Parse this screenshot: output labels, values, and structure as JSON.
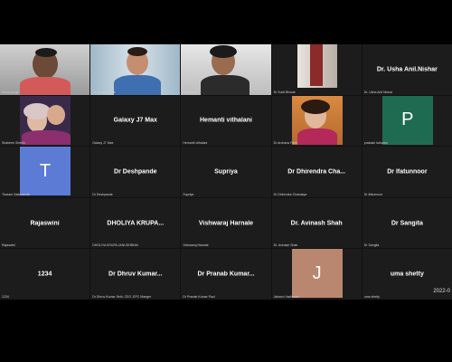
{
  "tiles": [
    {
      "center": "",
      "label": "aruna pooja"
    },
    {
      "center": "",
      "label": "Dr Archana Pate"
    },
    {
      "center": "",
      "label": "Ruhi Jasvi"
    },
    {
      "center": "",
      "label": "Dr Sunil Bhosle"
    },
    {
      "center": "Dr. Usha Anil.Nishar",
      "label": "Dr. Usha Anil Nishar"
    },
    {
      "center": "",
      "label": "Shaheen Sheikh"
    },
    {
      "center": "Galaxy J7 Max",
      "label": "Galaxy J7 Max"
    },
    {
      "center": "Hemanti vithalani",
      "label": "Hemanti vithalani"
    },
    {
      "center": "",
      "label": "Dr Archana Patel"
    },
    {
      "center": "",
      "label": "prakash bahadur"
    },
    {
      "center": "",
      "label": "Tharani Gaikwander"
    },
    {
      "center": "Dr Deshpande",
      "label": "Dr Deshpande"
    },
    {
      "center": "Supriya",
      "label": "Supriya"
    },
    {
      "center": "Dr Dhirendra Cha...",
      "label": "Dr Dhirendra Chanakya"
    },
    {
      "center": "Dr Ifatunnoor",
      "label": "Dr Ifatunnoor"
    },
    {
      "center": "Rajaswini",
      "label": "Rajaswini"
    },
    {
      "center": "DHOLIYA KRUPA...",
      "label": "DHOLIYA KRUPA JANUSHBHAI"
    },
    {
      "center": "Vishwaraj Harnale",
      "label": "Vishwaraj Harnale"
    },
    {
      "center": "Dr. Avinash Shah",
      "label": "Dr. Avinash Shah"
    },
    {
      "center": "Dr Sangita",
      "label": "Dr Sangita"
    },
    {
      "center": "1234",
      "label": "1234"
    },
    {
      "center": "Dr Dhruv Kumar...",
      "label": "Dr Dhruv Kumar Seth, CEO ,EPC Manger"
    },
    {
      "center": "Dr Pranab Kumar...",
      "label": "Dr Pranab Kumar Paul"
    },
    {
      "center": "",
      "label": "Jahanvi Vadhwani"
    },
    {
      "center": "uma shetty",
      "label": "uma shetty"
    }
  ],
  "avatars": {
    "t_letter": "T",
    "p_letter": "P",
    "j_letter": "J"
  },
  "timestamp": "2022-0",
  "colors": {
    "t_bg": "#5b7bd5",
    "p_bg": "#1f6b52",
    "j_bg": "#b9876f"
  }
}
